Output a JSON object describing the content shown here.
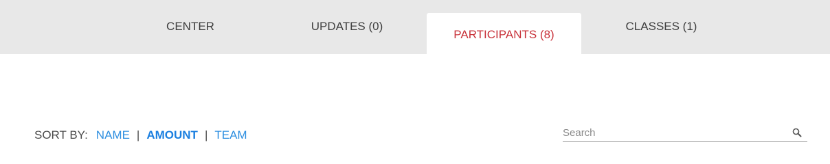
{
  "tabs": {
    "center": "CENTER",
    "updates": "UPDATES (0)",
    "participants": "PARTICIPANTS (8)",
    "classes": "CLASSES (1)",
    "active": "participants"
  },
  "sort": {
    "label": "SORT BY:",
    "options": [
      "NAME",
      "AMOUNT",
      "TEAM"
    ],
    "selected": "AMOUNT",
    "separator": "|"
  },
  "search": {
    "placeholder": "Search",
    "value": "",
    "icon": "search-icon"
  },
  "colors": {
    "tabbar_bg": "#e8e8e8",
    "active_tab_text": "#c8323a",
    "link": "#2e8fe0"
  }
}
